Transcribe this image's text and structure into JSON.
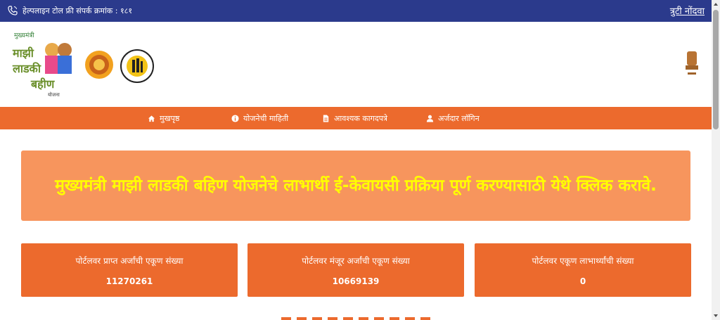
{
  "topbar": {
    "helpline_text": "हेल्पलाइन टोल फ्री संपर्क क्रमांक : १८१",
    "complaint_link": "त्रुटी नोंदवा",
    "background": "#2b3a8c"
  },
  "header": {
    "logo_text": {
      "top": "मुख्यमंत्री",
      "l1": "माझी",
      "l2": "लाडकी",
      "l3": "बहीण",
      "bottom": "योजना"
    }
  },
  "nav": {
    "items": [
      {
        "label": "मुखपृष्ठ",
        "icon": "home-icon"
      },
      {
        "label": "योजनेची माहिती",
        "icon": "info-icon"
      },
      {
        "label": "आवश्यक कागदपत्रे",
        "icon": "document-icon"
      },
      {
        "label": "अर्जदार लॉगिन",
        "icon": "user-icon"
      }
    ],
    "background": "#ec6a2d"
  },
  "banner": {
    "text": "मुख्यमंत्री माझी लाडकी बहिण योजनेचे लाभार्थी ई-केवायसी प्रक्रिया पूर्ण करण्यासाठी येथे क्लिक करावे.",
    "text_color": "#ffff00",
    "background": "#f7955d"
  },
  "stats": [
    {
      "label": "पोर्टलवर प्राप्त अर्जांची एकूण संख्या",
      "value": "11270261"
    },
    {
      "label": "पोर्टलवर मंजूर अर्जांची एकूण संख्या",
      "value": "10669139"
    },
    {
      "label": "पोर्टलवर एकूण लाभार्थ्यांची संख्या",
      "value": "0"
    }
  ]
}
